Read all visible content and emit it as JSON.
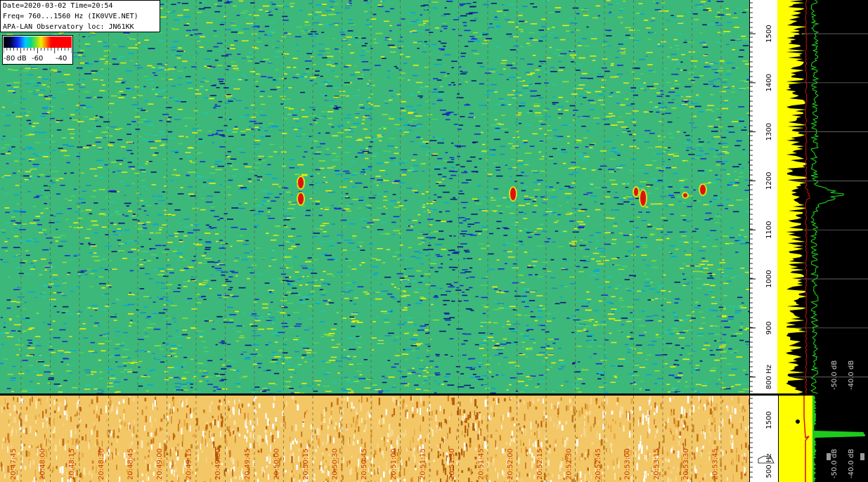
{
  "info": {
    "line1": "Date=2020-03-02 Time=20:54",
    "line2": "Freq= 760...1560 Hz (IK0VVE.NET)",
    "line3": "APA-LAN Observatory loc: JN61KK"
  },
  "colorbar": {
    "labels": [
      "-80 dB",
      "-60",
      "-40"
    ]
  },
  "freq_axis": {
    "labels": [
      "1500",
      "1400",
      "1300",
      "1200",
      "1100",
      "1000",
      "900",
      "800 Hz"
    ]
  },
  "bottom_axis": {
    "labels": [
      "1500",
      "500 Hz"
    ]
  },
  "spectrum": {
    "db_labels": [
      "-50.0 dB",
      "-40.0 dB"
    ]
  },
  "bottom_spectrum": {
    "db_labels": [
      "-50.0 dB",
      "-40.0 dB"
    ]
  },
  "time_axis": {
    "labels": [
      "20:47:45",
      "20:48:00",
      "20:48:15",
      "20:48:30",
      "20:48:45",
      "20:49:00",
      "20:49:15",
      "20:49:30",
      "20:49:45",
      "20:50:00",
      "20:50:15",
      "20:50:30",
      "20:50:45",
      "20:51:00",
      "20:51:15",
      "20:51:30",
      "20:51:45",
      "20:52:00",
      "20:52:15",
      "20:52:30",
      "20:52:45",
      "20:53:00",
      "20:53:15",
      "20:53:30",
      "20:53:45"
    ]
  },
  "colors": {
    "waterfall_base": "#3cb87a",
    "strip_base": "#f3c766",
    "trace_yellow": "#ffff00",
    "trace_green": "#20e020",
    "trace_red": "#d01010"
  }
}
